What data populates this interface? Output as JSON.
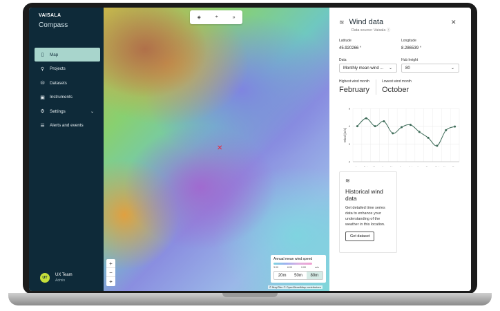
{
  "sidebar": {
    "brand": "VAISALA",
    "product": "Compass",
    "items": [
      {
        "label": "Map",
        "icon": "map-icon"
      },
      {
        "label": "Projects",
        "icon": "projects-icon"
      },
      {
        "label": "Datasets",
        "icon": "database-icon"
      },
      {
        "label": "Instruments",
        "icon": "instrument-icon"
      },
      {
        "label": "Settings",
        "icon": "gear-icon"
      },
      {
        "label": "Alerts and events",
        "icon": "list-icon"
      }
    ],
    "user": {
      "initials": "UT",
      "name": "UX Team",
      "role": "Admin"
    }
  },
  "map": {
    "legend": {
      "title": "Annual mean wind speed",
      "ticks": [
        "3.00",
        "6.00",
        "9.00",
        "m/s"
      ],
      "hub_options": [
        "20m",
        "50m",
        "80m"
      ],
      "selected": "80m"
    },
    "attribution": "© MapTiler © OpenStreetMap contributors"
  },
  "panel": {
    "title": "Wind data",
    "source": "Data source: Vaisala",
    "latitude_label": "Latitude",
    "latitude": "45.920266 °",
    "longitude_label": "Longitude",
    "longitude": "8.286539 °",
    "data_label": "Data",
    "data_value": "Monthly mean wind ...",
    "hub_label": "Hub height",
    "hub_value": "80",
    "highest_label": "Highest wind month",
    "highest": "February",
    "lowest_label": "Lowest wind month",
    "lowest": "October",
    "card": {
      "title": "Historical wind data",
      "text": "Get detailed time series data to enhance your understanding of the weather in this location.",
      "button": "Get dataset"
    }
  },
  "chart_data": {
    "type": "line",
    "ylabel": "Wind [m/s]",
    "credit": "Highcharts.com",
    "categories": [
      "Jan",
      "Feb",
      "Mar",
      "Apr",
      "May",
      "Jun",
      "Jul",
      "Aug",
      "Sep",
      "Oct",
      "Nov",
      "Dec"
    ],
    "values": [
      4.0,
      4.45,
      4.0,
      4.28,
      3.6,
      3.95,
      4.08,
      3.68,
      3.35,
      2.9,
      3.78,
      3.98
    ],
    "ylim": [
      2,
      5
    ],
    "yticks": [
      "2",
      "3",
      "4",
      "5"
    ],
    "grid": true,
    "color": "#3d6b58"
  }
}
